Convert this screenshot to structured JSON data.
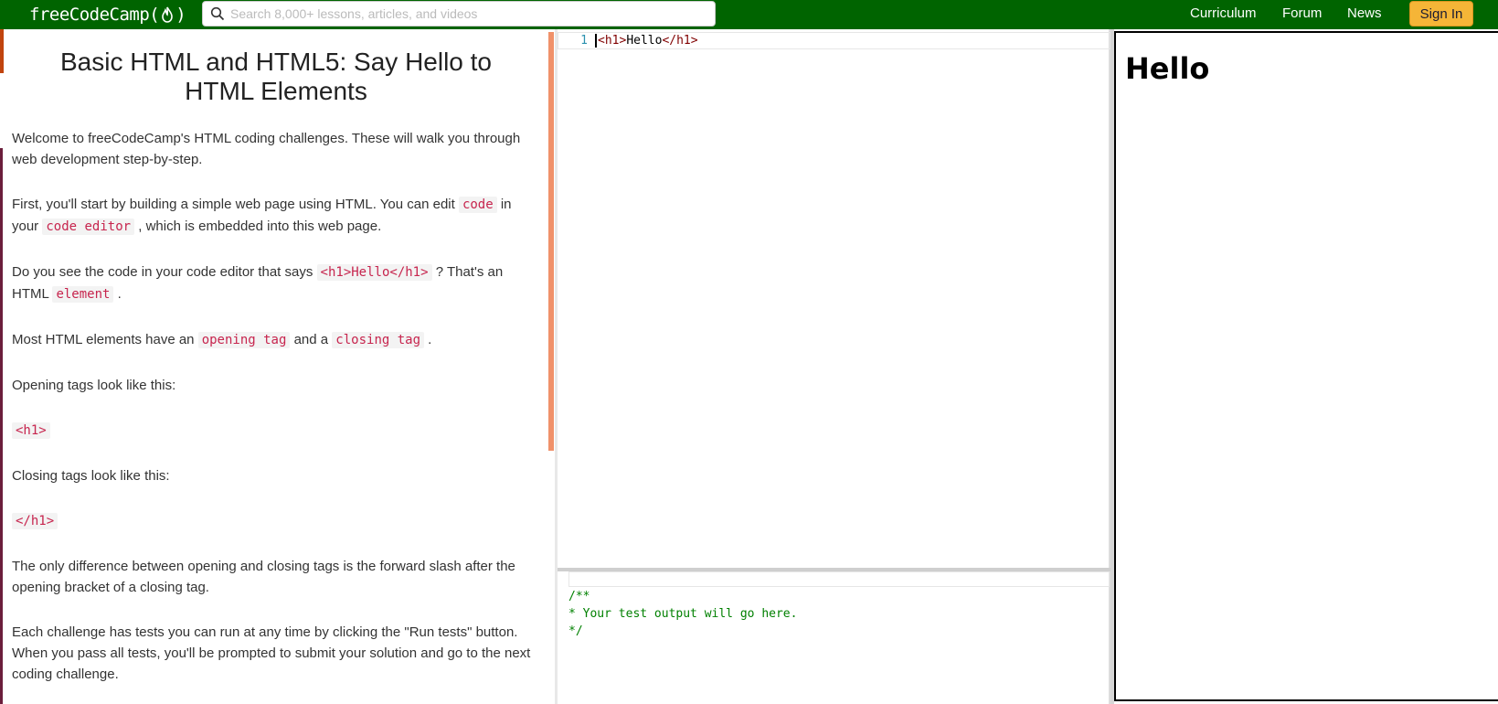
{
  "navbar": {
    "logo_text_left": "freeCodeCamp(",
    "logo_text_right": ")",
    "search_placeholder": "Search 8,000+ lessons, articles, and videos",
    "links": [
      "Curriculum",
      "Forum",
      "News"
    ],
    "sign_in": "Sign In",
    "bg_color": "#006400",
    "sign_in_color": "#f5b537"
  },
  "challenge": {
    "title": "Basic HTML and HTML5: Say Hello to HTML Elements",
    "p1": "Welcome to freeCodeCamp's HTML coding challenges. These will walk you through web development step-by-step.",
    "p2_a": "First, you'll start by building a simple web page using HTML. You can edit ",
    "p2_code1": "code",
    "p2_b": " in your ",
    "p2_code2": "code editor",
    "p2_c": " , which is embedded into this web page.",
    "p3_a": "Do you see the code in your code editor that says ",
    "p3_code1": "<h1>Hello</h1>",
    "p3_b": " ? That's an HTML ",
    "p3_code2": "element",
    "p3_c": " .",
    "p4_a": "Most HTML elements have an ",
    "p4_code1": "opening tag",
    "p4_b": " and a ",
    "p4_code2": "closing tag",
    "p4_c": " .",
    "p5": "Opening tags look like this:",
    "p6_code": "<h1>",
    "p7": "Closing tags look like this:",
    "p8_code": "</h1>",
    "p9": "The only difference between opening and closing tags is the forward slash after the opening bracket of a closing tag.",
    "p10": "Each challenge has tests you can run at any time by clicking the \"Run tests\" button. When you pass all tests, you'll be prompted to submit your solution and go to the next coding challenge."
  },
  "editor": {
    "line_number": "1",
    "tag_open": "<h1>",
    "content": "Hello",
    "tag_close": "</h1>"
  },
  "console": {
    "output": "/**\n* Your test output will go here.\n*/"
  },
  "preview": {
    "heading": "Hello"
  }
}
